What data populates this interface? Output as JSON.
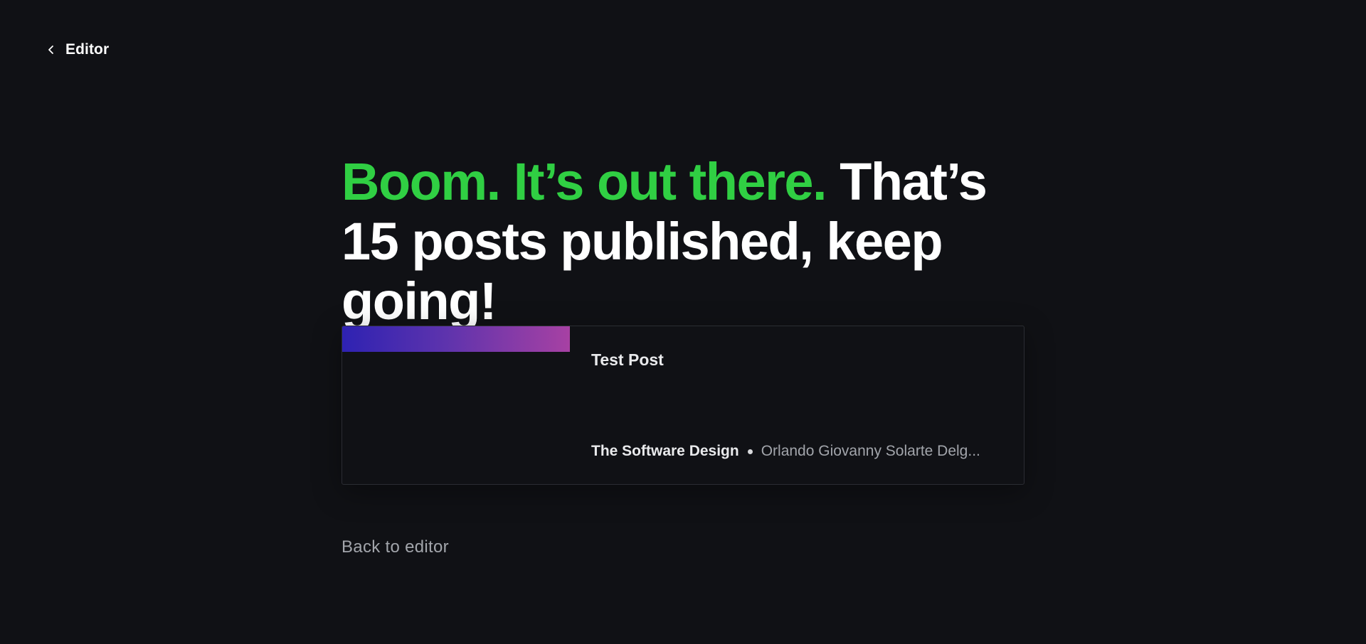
{
  "nav": {
    "back_label": "Editor"
  },
  "headline": {
    "accent": "Boom. It’s out there.",
    "rest": " That’s 15 posts published, keep going!"
  },
  "post_card": {
    "title": "Test Post",
    "publication": "The Software Design",
    "author": "Orlando Giovanny Solarte Delg..."
  },
  "footer": {
    "back_to_editor": "Back to editor"
  },
  "colors": {
    "background": "#101115",
    "accent_green": "#30cf43",
    "text_primary": "#ffffff",
    "text_muted": "#a2a5ab",
    "feature_gradient_start": "#2e22b2",
    "feature_gradient_end": "#a741a3"
  },
  "icons": {
    "back": "chevron-left-icon"
  }
}
